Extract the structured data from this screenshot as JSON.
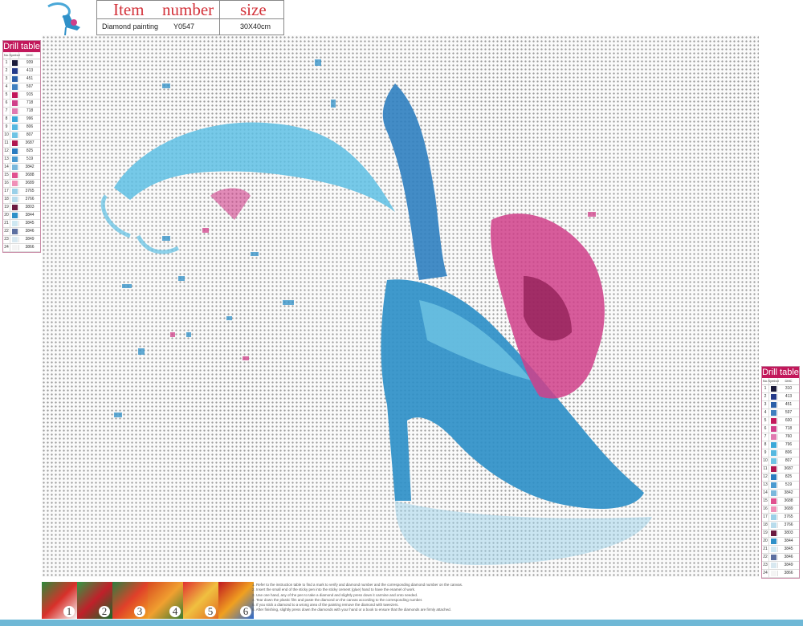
{
  "header": {
    "item_label": "Item",
    "number_label": "number",
    "size_label": "size",
    "item_value": "Diamond painting",
    "number_value": "Y0547",
    "size_value": "30X40cm"
  },
  "drill_table_left": {
    "title": "Drill table",
    "col_no": "No.",
    "col_symbol": "Symbol",
    "col_dmc": "DMC",
    "rows": [
      {
        "no": "1",
        "color": "#1a1a3a",
        "code": "939"
      },
      {
        "no": "2",
        "color": "#243a8a",
        "code": "413"
      },
      {
        "no": "3",
        "color": "#2a5fa8",
        "code": "451"
      },
      {
        "no": "4",
        "color": "#3f7fbf",
        "code": "597"
      },
      {
        "no": "5",
        "color": "#c2185b",
        "code": "915"
      },
      {
        "no": "6",
        "color": "#d0408a",
        "code": "718"
      },
      {
        "no": "7",
        "color": "#e07ab0",
        "code": "718"
      },
      {
        "no": "8",
        "color": "#3aa8d8",
        "code": "996"
      },
      {
        "no": "9",
        "color": "#55b8e0",
        "code": "806"
      },
      {
        "no": "10",
        "color": "#6fc4e4",
        "code": "807"
      },
      {
        "no": "11",
        "color": "#b01850",
        "code": "3687"
      },
      {
        "no": "12",
        "color": "#2b7cc0",
        "code": "825"
      },
      {
        "no": "13",
        "color": "#4a9ad0",
        "code": "519"
      },
      {
        "no": "14",
        "color": "#7ab8dc",
        "code": "3842"
      },
      {
        "no": "15",
        "color": "#e0508f",
        "code": "3688"
      },
      {
        "no": "16",
        "color": "#f090b8",
        "code": "3689"
      },
      {
        "no": "17",
        "color": "#9ad0e8",
        "code": "3765"
      },
      {
        "no": "18",
        "color": "#b8dcec",
        "code": "3766"
      },
      {
        "no": "19",
        "color": "#6a1a40",
        "code": "3803"
      },
      {
        "no": "20",
        "color": "#2e90c8",
        "code": "3844"
      },
      {
        "no": "21",
        "color": "#cfe8f2",
        "code": "3845"
      },
      {
        "no": "22",
        "color": "#5c6fa0",
        "code": "3846"
      },
      {
        "no": "23",
        "color": "#d8e8f0",
        "code": "3849"
      },
      {
        "no": "24",
        "color": "#f4f4f4",
        "code": "3866"
      }
    ]
  },
  "drill_table_right": {
    "title": "Drill table",
    "col_no": "No.",
    "col_symbol": "Symbol",
    "col_dmc": "DMC",
    "rows": [
      {
        "no": "1",
        "color": "#1a1a3a",
        "code": "310"
      },
      {
        "no": "2",
        "color": "#243a8a",
        "code": "413"
      },
      {
        "no": "3",
        "color": "#2a5fa8",
        "code": "451"
      },
      {
        "no": "4",
        "color": "#3f7fbf",
        "code": "597"
      },
      {
        "no": "5",
        "color": "#c2185b",
        "code": "600"
      },
      {
        "no": "6",
        "color": "#d0408a",
        "code": "718"
      },
      {
        "no": "7",
        "color": "#e07ab0",
        "code": "760"
      },
      {
        "no": "8",
        "color": "#3aa8d8",
        "code": "796"
      },
      {
        "no": "9",
        "color": "#55b8e0",
        "code": "806"
      },
      {
        "no": "10",
        "color": "#6fc4e4",
        "code": "807"
      },
      {
        "no": "11",
        "color": "#b01850",
        "code": "3687"
      },
      {
        "no": "12",
        "color": "#2b7cc0",
        "code": "825"
      },
      {
        "no": "13",
        "color": "#4a9ad0",
        "code": "519"
      },
      {
        "no": "14",
        "color": "#7ab8dc",
        "code": "3842"
      },
      {
        "no": "15",
        "color": "#e0508f",
        "code": "3688"
      },
      {
        "no": "16",
        "color": "#f090b8",
        "code": "3689"
      },
      {
        "no": "17",
        "color": "#9ad0e8",
        "code": "3765"
      },
      {
        "no": "18",
        "color": "#b8dcec",
        "code": "3766"
      },
      {
        "no": "19",
        "color": "#6a1a40",
        "code": "3803"
      },
      {
        "no": "20",
        "color": "#2e90c8",
        "code": "3844"
      },
      {
        "no": "21",
        "color": "#cfe8f2",
        "code": "3845"
      },
      {
        "no": "22",
        "color": "#5c6fa0",
        "code": "3846"
      },
      {
        "no": "23",
        "color": "#d8e8f0",
        "code": "3849"
      },
      {
        "no": "24",
        "color": "#f4f4f4",
        "code": "3866"
      }
    ]
  },
  "steps": [
    {
      "num": "1",
      "colors": [
        "#2a8a3a",
        "#d8302a",
        "#f4f4f4"
      ]
    },
    {
      "num": "2",
      "colors": [
        "#2f9a44",
        "#c0202a",
        "#146c2a"
      ]
    },
    {
      "num": "3",
      "colors": [
        "#2a8040",
        "#e0402a",
        "#f0a020"
      ]
    },
    {
      "num": "4",
      "colors": [
        "#d84a20",
        "#f0a030",
        "#3a7a30"
      ]
    },
    {
      "num": "5",
      "colors": [
        "#e03030",
        "#f0c040",
        "#e06a20"
      ]
    },
    {
      "num": "6",
      "colors": [
        "#c01820",
        "#f0a020",
        "#2a6ad0"
      ]
    }
  ],
  "instructions": [
    "1. Refer to the instruction table to find a mark to verify and diamond number and the corresponding diamond number on the canvas.",
    "2. Insert the small end of the sticky pen into the sticky cement (glue) hand to have the enamel of work.",
    "3. Use one hand, any of the pen to take a diamond and slightly press down it carmine and onto needed.",
    "4. Tear down the plastic film and paste the diamond on the canvas according to the corresponding number.",
    "5. If you stick a diamond to a wrong area of the painting remove the diamond with tweezers.",
    "6. After finishing, slightly press down the diamonds with your hand or a book to ensure that the diamonds are firmly attached."
  ],
  "colors": {
    "shoe_blue": "#2f90c8",
    "shoe_light": "#6fc4e4",
    "splash_pink": "#d0408a",
    "accent_magenta": "#c2185b",
    "frame_blue": "#6fb8d6"
  }
}
